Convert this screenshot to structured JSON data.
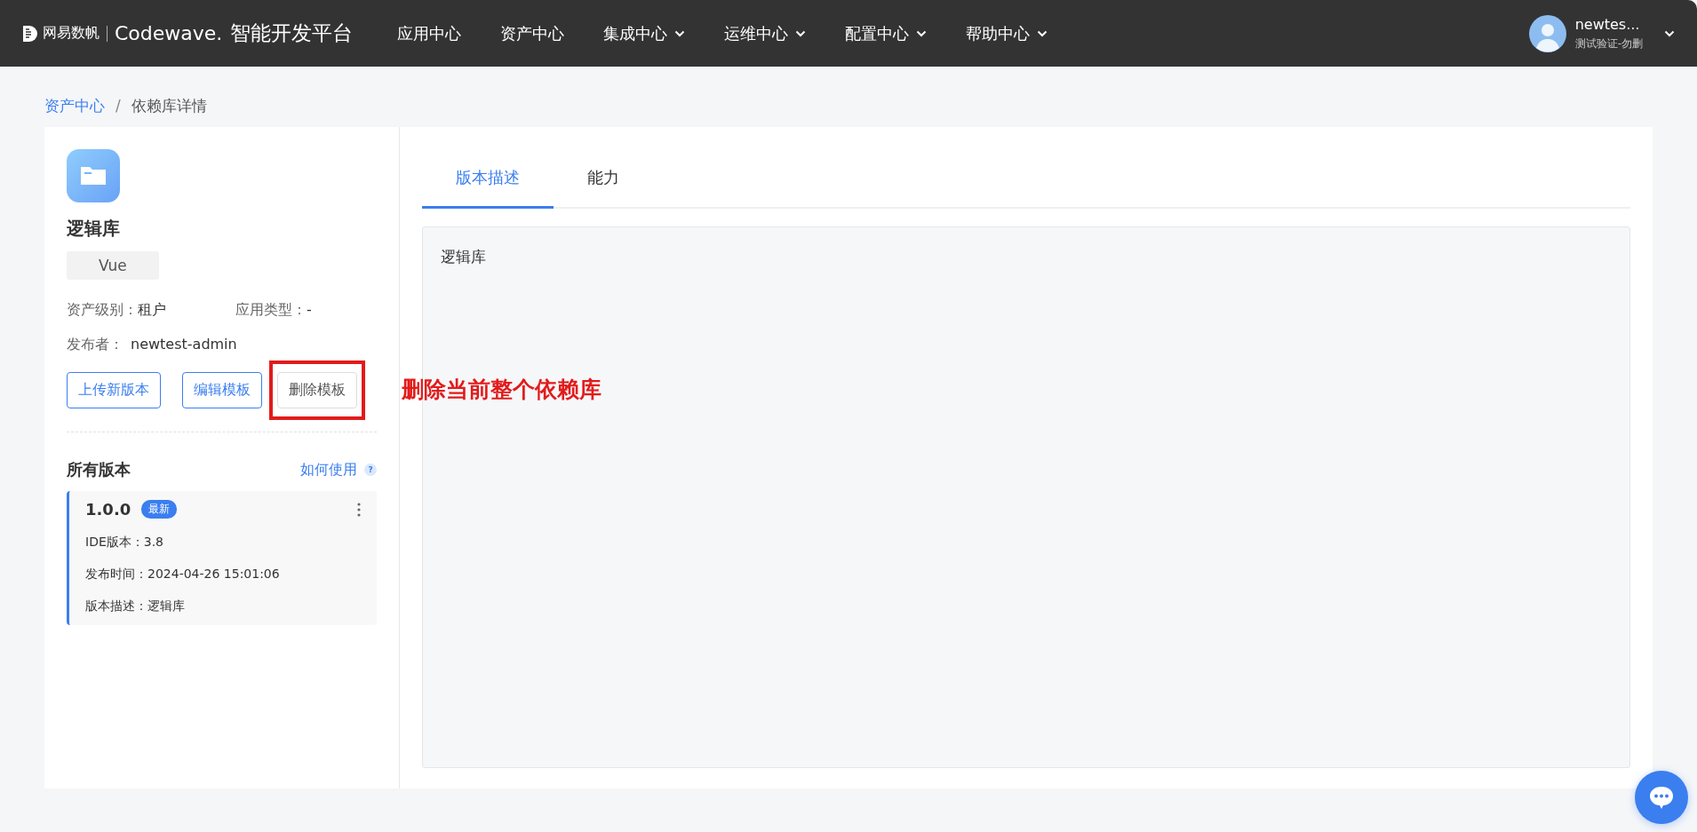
{
  "header": {
    "brand": "网易数帆",
    "product": "Codewave.",
    "platform": "智能开发平台",
    "nav": [
      {
        "label": "应用中心",
        "dropdown": false
      },
      {
        "label": "资产中心",
        "dropdown": false
      },
      {
        "label": "集成中心",
        "dropdown": true
      },
      {
        "label": "运维中心",
        "dropdown": true
      },
      {
        "label": "配置中心",
        "dropdown": true
      },
      {
        "label": "帮助中心",
        "dropdown": true
      }
    ],
    "user": {
      "name": "newtes...",
      "tenant": "测试验证-勿删"
    }
  },
  "breadcrumb_separator": "/",
  "breadcrumb": [
    {
      "label": "资产中心",
      "link": true
    },
    {
      "label": "依赖库详情",
      "link": false
    }
  ],
  "library": {
    "name": "逻辑库",
    "tag": "Vue",
    "info": [
      {
        "label": "资产级别：",
        "value": "租户"
      },
      {
        "label": "应用类型：",
        "value": "-"
      },
      {
        "label": "发布者：",
        "value": "newtest-admin"
      }
    ],
    "buttons": [
      {
        "label": "上传新版本",
        "kind": "primary",
        "highlighted": false
      },
      {
        "label": "编辑模板",
        "kind": "primary",
        "highlighted": false
      },
      {
        "label": "删除模板",
        "kind": "default",
        "highlighted": true
      }
    ],
    "annotation": "删除当前整个依赖库"
  },
  "versions": {
    "title": "所有版本",
    "help_link": "如何使用",
    "help_icon": "?",
    "items": [
      {
        "version": "1.0.0",
        "badge": "最新",
        "selected": true,
        "fields": [
          "IDE版本：3.8",
          "发布时间：2024-04-26 15:01:06",
          "版本描述：逻辑库"
        ]
      }
    ]
  },
  "tabs": [
    {
      "label": "版本描述",
      "selected": true
    },
    {
      "label": "能力",
      "selected": false
    }
  ],
  "content": "逻辑库"
}
